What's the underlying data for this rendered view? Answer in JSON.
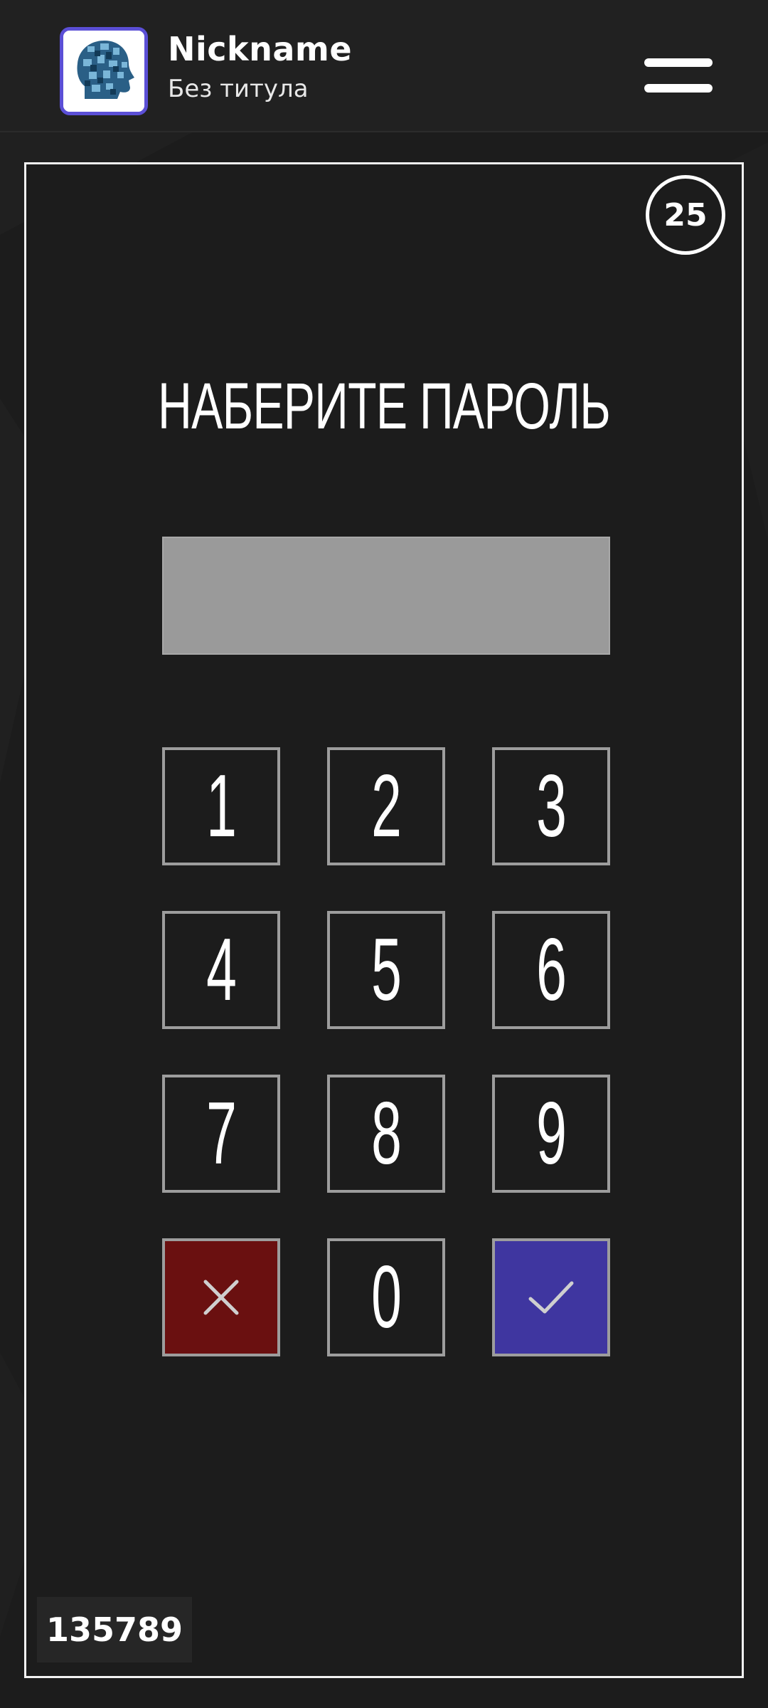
{
  "header": {
    "nickname": "Nickname",
    "subtitle": "Без титула",
    "avatar_icon": "head-portrait-icon",
    "menu_icon": "hamburger-menu-icon",
    "accent_color": "#5b4fd6"
  },
  "game": {
    "timer": "25",
    "title": "НАБЕРИТЕ ПАРОЛЬ",
    "display_value": "",
    "keys": {
      "k1": "1",
      "k2": "2",
      "k3": "3",
      "k4": "4",
      "k5": "5",
      "k6": "6",
      "k7": "7",
      "k8": "8",
      "k9": "9",
      "k0": "0"
    },
    "cancel_icon": "close-icon",
    "confirm_icon": "checkmark-icon",
    "cancel_color": "#6a1010",
    "confirm_color": "#3f36a0",
    "code": "135789"
  }
}
